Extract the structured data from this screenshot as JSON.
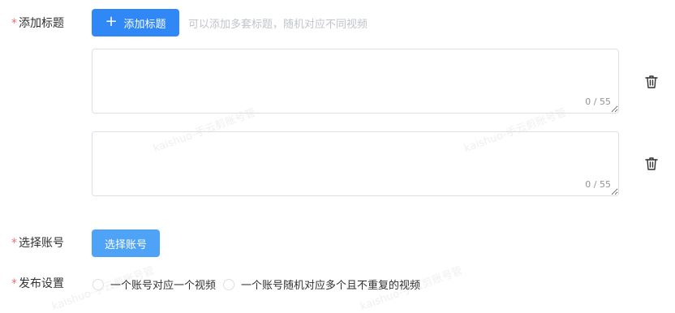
{
  "titles": {
    "required_mark": "*",
    "label": "添加标题",
    "add_button_label": "添加标题",
    "add_button_icon": "plus-icon",
    "hint": "可以添加多套标题，随机对应不同视频",
    "items": [
      {
        "value": "",
        "counter": "0 / 55",
        "delete_icon": "trash-icon"
      },
      {
        "value": "",
        "counter": "0 / 55",
        "delete_icon": "trash-icon"
      }
    ]
  },
  "account": {
    "required_mark": "*",
    "label": "选择账号",
    "button_label": "选择账号"
  },
  "publish": {
    "required_mark": "*",
    "label": "发布设置",
    "options": [
      {
        "label": "一个账号对应一个视频",
        "selected": false
      },
      {
        "label": "一个账号随机对应多个且不重复的视频",
        "selected": false
      }
    ]
  },
  "watermark": "kaishuo-手云剪账号管",
  "colors": {
    "primary": "#2f88f5",
    "required": "#f56c6c",
    "border": "#dcdfe6"
  }
}
